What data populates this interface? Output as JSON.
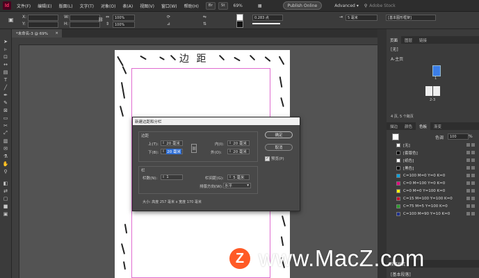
{
  "app": {
    "logo": "Id"
  },
  "menubar": {
    "items": [
      "文件(F)",
      "编辑(E)",
      "版面(L)",
      "文字(T)",
      "对象(O)",
      "表(A)",
      "视图(V)",
      "窗口(W)",
      "帮助(H)"
    ],
    "br_badge": "Br",
    "st_badge": "St",
    "zoom": "69%",
    "publish_online": "Publish Online",
    "workspace": "Advanced",
    "search_placeholder": "Adobe Stock"
  },
  "controlbar": {
    "x_label": "X:",
    "y_label": "Y:",
    "w_label": "W:",
    "h_label": "H:",
    "stroke_weight": "0.283 点",
    "gap": "5 毫米",
    "style": "[基本图形框架]",
    "percent_a": "100%",
    "percent_b": "100%"
  },
  "document": {
    "tab_title": "*未命名-3 @ 69%",
    "page_heading": "边 距"
  },
  "dialog": {
    "title": "新建边距和分栏",
    "margins_label": "边距",
    "top_label": "上(T):",
    "top_value": "20 毫米",
    "bottom_label": "下(B):",
    "bottom_value": "20 毫米",
    "inside_label": "内(I):",
    "inside_value": "20 毫米",
    "outside_label": "外(O):",
    "outside_value": "20 毫米",
    "columns_label": "栏",
    "count_label": "栏数(N):",
    "count_value": "1",
    "gutter_label": "栏间距(G):",
    "gutter_value": "5 毫米",
    "direction_label": "排版方向(W):",
    "direction_value": "水平",
    "size_text": "大小: 高度 257 毫米 x 宽度 170 毫米",
    "ok_label": "确定",
    "cancel_label": "取消",
    "preview_label": "预览(P)"
  },
  "pages_panel": {
    "tabs": [
      "页面",
      "图层",
      "链接"
    ],
    "none_label": "[无]",
    "master_label": "A-主页",
    "page_number": "1",
    "spread_label": "2-3",
    "footer": "4 页, 5 个跨页"
  },
  "swatches_panel": {
    "tabs": [
      "描边",
      "颜色",
      "色板",
      "渐变"
    ],
    "tint_label": "色调",
    "tint_value": "100",
    "percent_sign": "%",
    "swatches": [
      {
        "name": "[无]",
        "color": "#ffffff"
      },
      {
        "name": "[套版色]",
        "color": "#000000"
      },
      {
        "name": "[纸色]",
        "color": "#ffffff"
      },
      {
        "name": "[黑色]",
        "color": "#000000"
      },
      {
        "name": "C=100 M=0 Y=0 K=0",
        "color": "#00a3e0"
      },
      {
        "name": "C=0 M=100 Y=0 K=0",
        "color": "#e4007f"
      },
      {
        "name": "C=0 M=0 Y=100 K=0",
        "color": "#fff100"
      },
      {
        "name": "C=15 M=100 Y=100 K=0",
        "color": "#c8102e"
      },
      {
        "name": "C=75 M=5 Y=100 K=0",
        "color": "#2ca02c"
      },
      {
        "name": "C=100 M=90 Y=10 K=0",
        "color": "#1c2f8f"
      }
    ]
  },
  "bottom_panel": {
    "title": "段落样式",
    "style": "[基本段落]"
  },
  "watermark": {
    "logo": "Z",
    "text": "www.MacZ.com"
  }
}
